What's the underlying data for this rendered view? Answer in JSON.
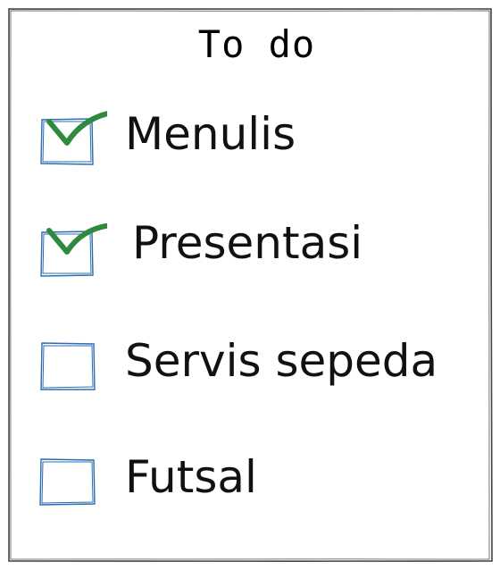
{
  "title": "To do",
  "todos": [
    {
      "label": "Menulis",
      "checked": true
    },
    {
      "label": "Presentasi",
      "checked": true
    },
    {
      "label": "Servis sepeda",
      "checked": false
    },
    {
      "label": "Futsal",
      "checked": false
    }
  ],
  "colors": {
    "frame": "#444444",
    "checkbox": "#2b6cb0",
    "checkmark": "#2f8a3e",
    "text": "#111111"
  }
}
